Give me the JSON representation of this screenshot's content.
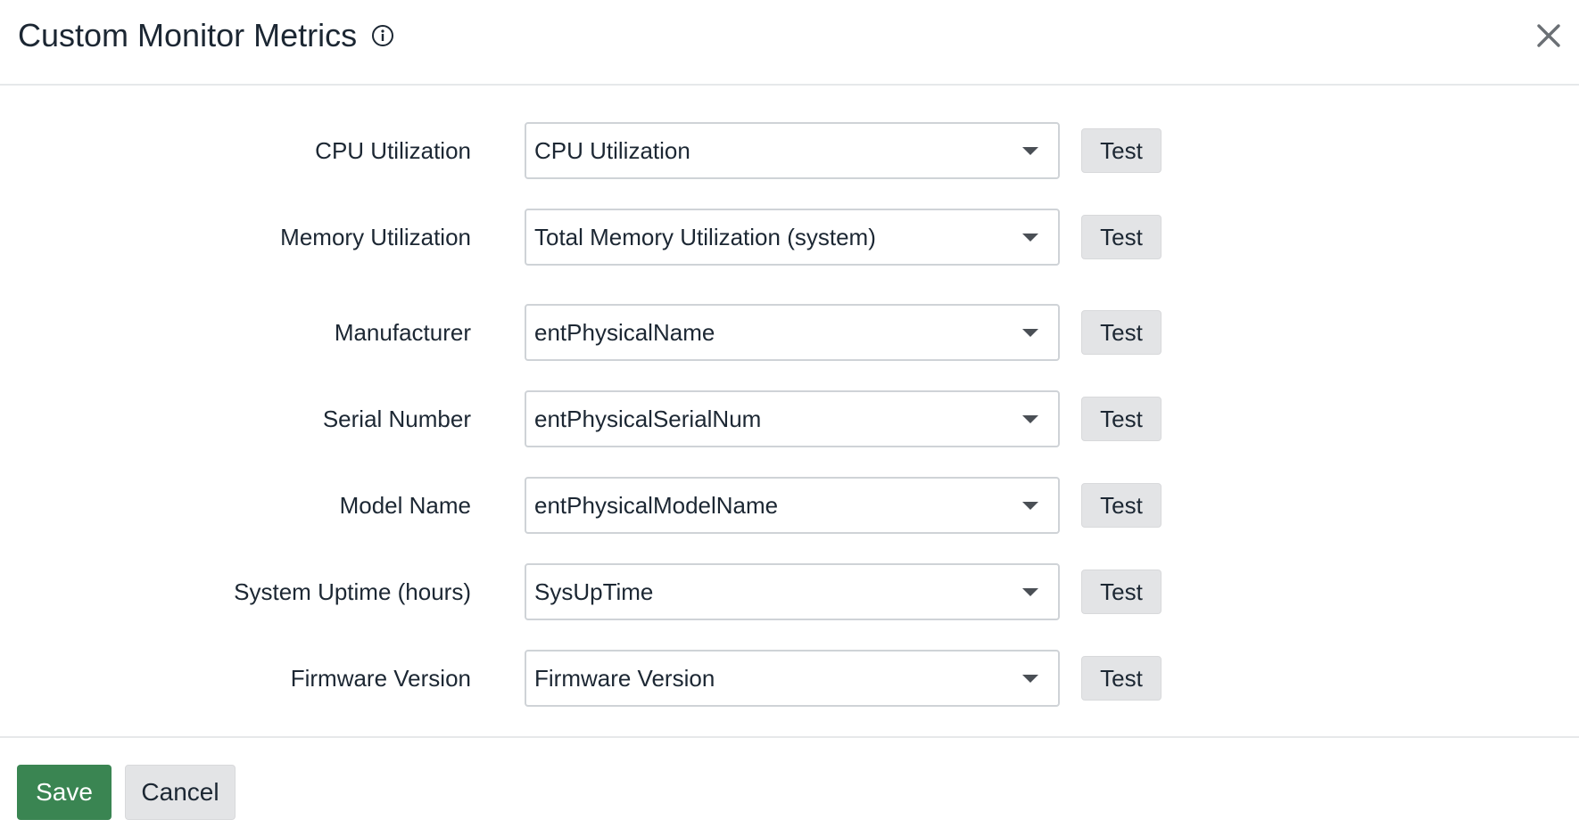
{
  "dialog": {
    "title": "Custom Monitor Metrics",
    "info_icon": "info-icon",
    "close_icon": "close-icon"
  },
  "metrics": [
    {
      "label": "CPU Utilization",
      "value": "CPU Utilization",
      "test_label": "Test"
    },
    {
      "label": "Memory Utilization",
      "value": "Total Memory Utilization (system)",
      "test_label": "Test"
    },
    {
      "label": "Manufacturer",
      "value": "entPhysicalName",
      "test_label": "Test"
    },
    {
      "label": "Serial Number",
      "value": "entPhysicalSerialNum",
      "test_label": "Test"
    },
    {
      "label": "Model Name",
      "value": "entPhysicalModelName",
      "test_label": "Test"
    },
    {
      "label": "System Uptime (hours)",
      "value": "SysUpTime",
      "test_label": "Test"
    },
    {
      "label": "Firmware Version",
      "value": "Firmware Version",
      "test_label": "Test"
    }
  ],
  "footer": {
    "save_label": "Save",
    "cancel_label": "Cancel"
  },
  "colors": {
    "primary": "#3a8552",
    "secondary_button": "#e3e4e6",
    "divider": "#e6e8ea",
    "text": "#1c2733"
  }
}
